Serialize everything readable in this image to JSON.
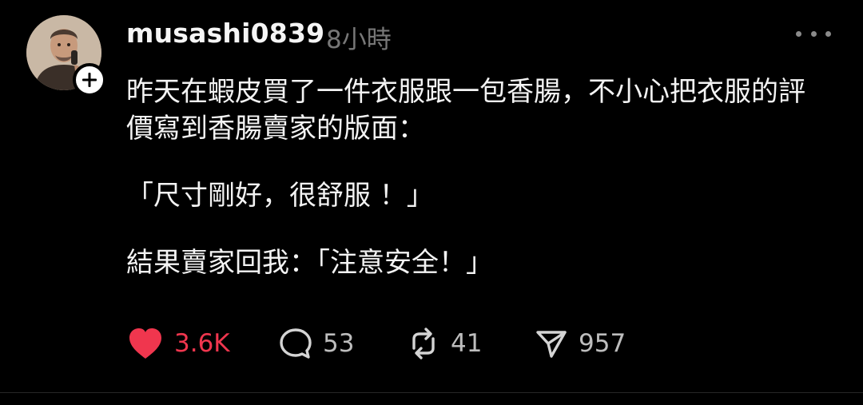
{
  "post": {
    "username": "musashi0839",
    "time": "8小時",
    "paragraphs": [
      "昨天在蝦皮買了一件衣服跟一包香腸，不小心把衣服的評價寫到香腸賣家的版面：",
      "「尺寸剛好，很舒服 ！」",
      "結果賣家回我：「注意安全！」"
    ]
  },
  "actions": {
    "likes": "3.6K",
    "replies": "53",
    "reposts": "41",
    "shares": "957"
  },
  "colors": {
    "background": "#000000",
    "like": "#f0364e",
    "text": "#f3f3f3",
    "muted": "#777777"
  }
}
